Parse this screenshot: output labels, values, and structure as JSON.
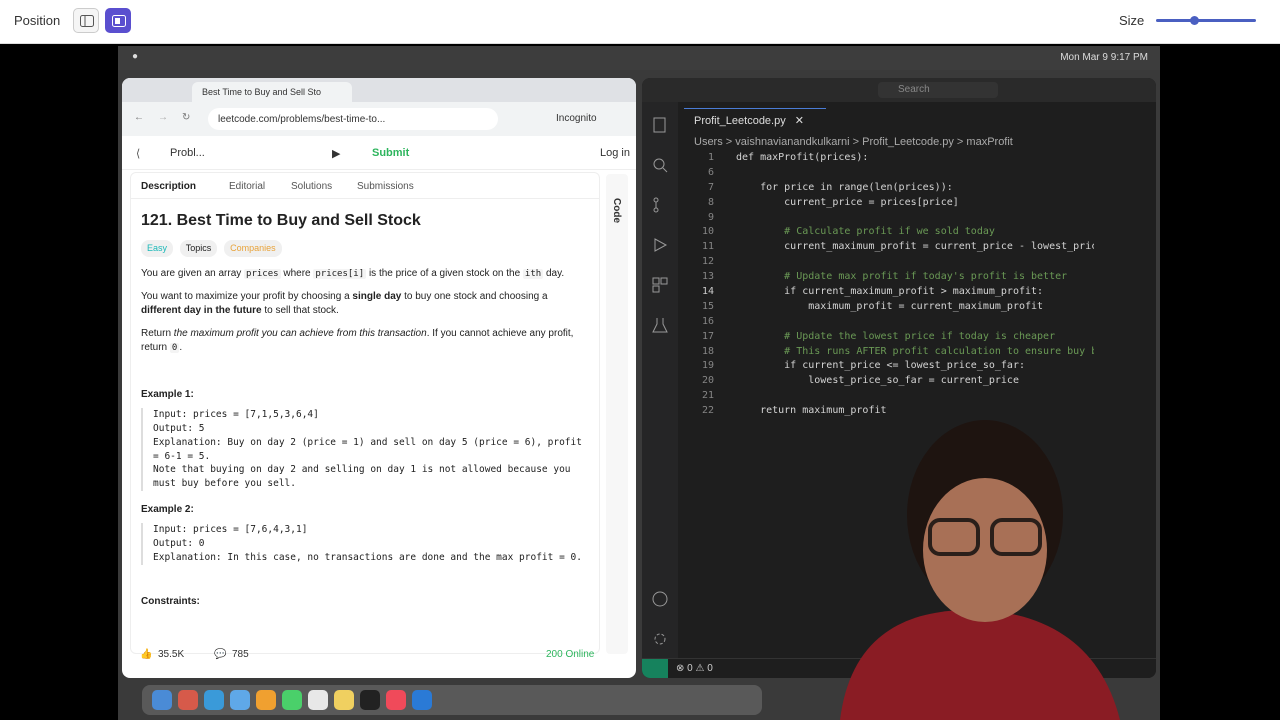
{
  "topbar": {
    "position_label": "Position",
    "size_label": "Size",
    "size_level": 0.38
  },
  "menubar": {
    "time": "Mon Mar 9 9:17 PM"
  },
  "browser": {
    "tab_title": "Best Time to Buy and Sell Sto",
    "url": "leetcode.com/problems/best-time-to...",
    "incognito": "Incognito",
    "nav": {
      "problems": "Probl...",
      "submit": "Submit",
      "login": "Log in"
    },
    "tabs": [
      "Description",
      "Editorial",
      "Solutions",
      "Submissions"
    ],
    "problem": {
      "title": "121. Best Time to Buy and Sell Stock",
      "difficulty": "Easy",
      "topics": "Topics",
      "companies": "Companies",
      "p1_a": "You are given an array",
      "p1_code1": "prices",
      "p1_b": "where",
      "p1_code2": "prices[i]",
      "p1_c": "is the price of a given stock on the",
      "p1_code3": "ith",
      "p1_d": "day.",
      "p2_a": "You want to maximize your profit by choosing a",
      "p2_b": "single day",
      "p2_c": "to buy one stock and choosing a",
      "p2_d": "different day in the future",
      "p2_e": "to sell that stock.",
      "p3_a": "Return",
      "p3_b": "the maximum profit you can achieve from this transaction",
      "p3_c": ". If you cannot achieve any profit, return",
      "p3_code": "0",
      "p3_d": ".",
      "ex1_title": "Example 1:",
      "ex1": "Input: prices = [7,1,5,3,6,4]\nOutput: 5\nExplanation: Buy on day 2 (price = 1) and sell on day 5 (price = 6), profit = 6-1 = 5.\nNote that buying on day 2 and selling on day 1 is not allowed because you must buy before you sell.",
      "ex2_title": "Example 2:",
      "ex2": "Input: prices = [7,6,4,3,1]\nOutput: 0\nExplanation: In this case, no transactions are done and the max profit = 0.",
      "constraints": "Constraints:"
    },
    "side_label": "Code",
    "footer": {
      "likes": "35.5K",
      "comments": "785",
      "online": "200 Online"
    }
  },
  "vscode": {
    "search": "Search",
    "tab": "Profit_Leetcode.py",
    "crumbs": "Users  >  vaishnavianandkulkarni  >  Profit_Leetcode.py  >  maxProfit",
    "lines": [
      {
        "n": "1",
        "c": "def maxProfit(prices):"
      },
      {
        "n": "6",
        "c": ""
      },
      {
        "n": "7",
        "c": "    for price in range(len(prices)):"
      },
      {
        "n": "8",
        "c": "        current_price = prices[price]"
      },
      {
        "n": "9",
        "c": ""
      },
      {
        "n": "10",
        "c": "        # Calculate profit if we sold today"
      },
      {
        "n": "11",
        "c": "        current_maximum_profit = current_price - lowest_price"
      },
      {
        "n": "12",
        "c": ""
      },
      {
        "n": "13",
        "c": "        # Update max profit if today's profit is better"
      },
      {
        "n": "14",
        "c": "        if current_maximum_profit > maximum_profit:"
      },
      {
        "n": "15",
        "c": "            maximum_profit = current_maximum_profit"
      },
      {
        "n": "16",
        "c": ""
      },
      {
        "n": "17",
        "c": "        # Update the lowest price if today is cheaper"
      },
      {
        "n": "18",
        "c": "        # This runs AFTER profit calculation to ensure buy be"
      },
      {
        "n": "19",
        "c": "        if current_price <= lowest_price_so_far:"
      },
      {
        "n": "20",
        "c": "            lowest_price_so_far = current_price"
      },
      {
        "n": "21",
        "c": ""
      },
      {
        "n": "22",
        "c": "    return maximum_profit"
      }
    ],
    "status": "⊗ 0 ⚠ 0"
  }
}
